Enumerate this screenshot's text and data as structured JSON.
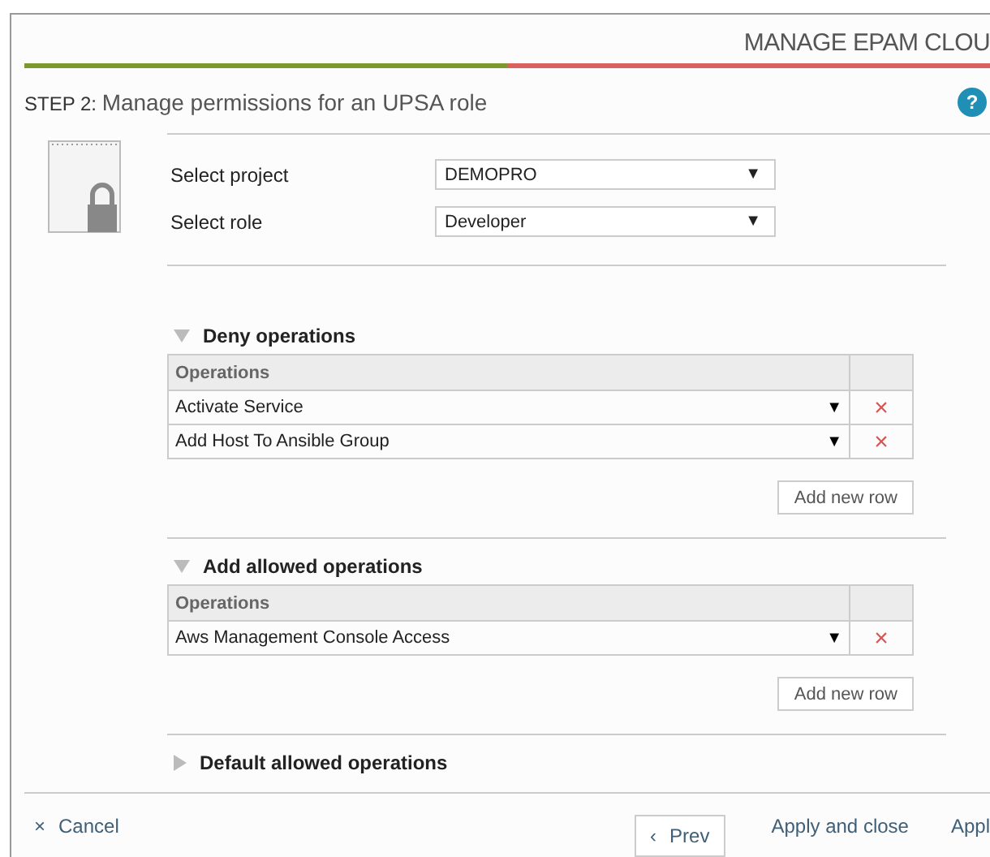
{
  "header": {
    "title": "MANAGE EPAM CLOU",
    "level": 0.5
  },
  "step": {
    "prefix": "STEP 2:",
    "title": "Manage permissions for an UPSA role",
    "help": "?"
  },
  "fields": [
    {
      "label": "Select project",
      "value": "DEMOPRO",
      "arrow": "▼"
    },
    {
      "label": "Select role",
      "value": "Developer",
      "arrow": "▼"
    }
  ],
  "sections": [
    {
      "title": "Deny operations",
      "expanded": true,
      "column_1": "Operations",
      "rows": [
        {
          "value": "Activate Service",
          "arrow": "▼",
          "remove": "×"
        },
        {
          "value": "Add Host To Ansible Group",
          "arrow": "▼",
          "remove": "×"
        }
      ],
      "button": "Add new row"
    },
    {
      "title": "Add allowed operations",
      "expanded": true,
      "column_1": "Operations",
      "rows": [
        {
          "value": "Aws Management Console Access",
          "arrow": "▼",
          "remove": "×"
        }
      ],
      "button": "Add new row"
    },
    {
      "title": "Default allowed operations",
      "expanded": false
    }
  ],
  "footer": {
    "cancel": "Cancel",
    "cancel_icon": "×",
    "prev_icon": "‹",
    "prev": "Prev",
    "apply_close": "Apply and close",
    "apply": "Appl"
  }
}
